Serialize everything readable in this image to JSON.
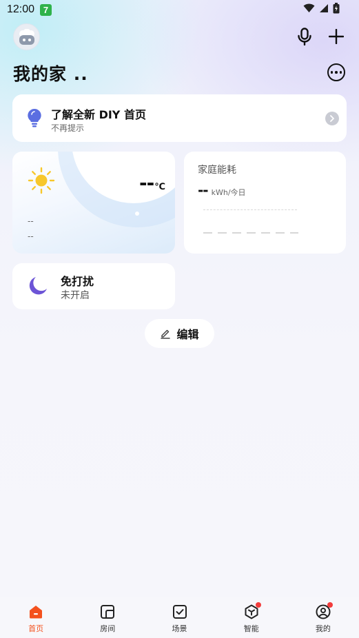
{
  "status_bar": {
    "time": "12:00",
    "app_badge": "7"
  },
  "header": {
    "title": "我的家 .."
  },
  "tip_card": {
    "title": "了解全新 DIY 首页",
    "subtitle": "不再提示"
  },
  "weather": {
    "temperature": "--",
    "unit": "℃",
    "line1": "--",
    "line2": "--"
  },
  "energy": {
    "title": "家庭能耗",
    "value": "--",
    "unit": "kWh/今日"
  },
  "dnd": {
    "title": "免打扰",
    "status": "未开启"
  },
  "edit": {
    "label": "编辑"
  },
  "tabs": [
    {
      "label": "首页",
      "icon": "home-icon",
      "active": true
    },
    {
      "label": "房间",
      "icon": "room-icon",
      "active": false
    },
    {
      "label": "场景",
      "icon": "scene-icon",
      "active": false
    },
    {
      "label": "智能",
      "icon": "smart-icon",
      "active": false,
      "badge": true
    },
    {
      "label": "我的",
      "icon": "profile-icon",
      "active": false,
      "badge": true
    }
  ],
  "colors": {
    "accent": "#f4511e",
    "badge": "#f23c3c",
    "bulb": "#5b6ee1",
    "moon": "#6c54d6",
    "sun": "#f7c72b"
  }
}
